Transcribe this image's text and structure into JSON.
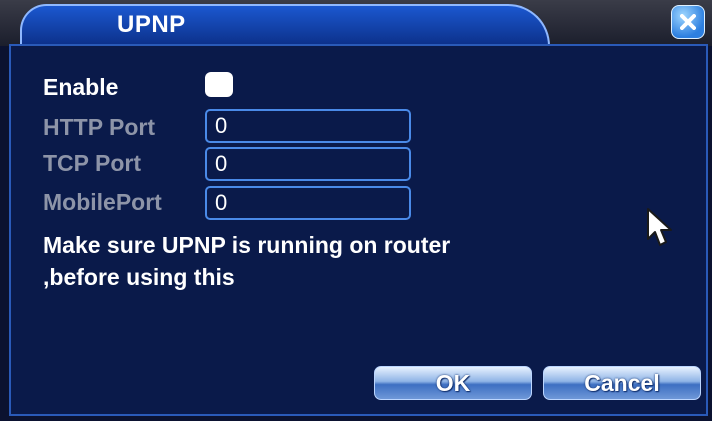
{
  "dialog": {
    "title": "UPNP",
    "close_icon": "close-x-icon"
  },
  "form": {
    "enable_label": "Enable",
    "enable_checked": false,
    "http_port_label": "HTTP Port",
    "http_port_value": "0",
    "tcp_port_label": "TCP Port",
    "tcp_port_value": "0",
    "mobile_port_label": "MobilePort",
    "mobile_port_value": "0"
  },
  "message": {
    "line1": "Make sure UPNP is running on router",
    "line2": ",before using this"
  },
  "buttons": {
    "ok_label": "OK",
    "cancel_label": "Cancel"
  },
  "colors": {
    "panel": "#0a1a4a",
    "title_tab": "#1b58d0",
    "field_border": "#4a8ae8",
    "disabled_text": "#8d94a8"
  }
}
